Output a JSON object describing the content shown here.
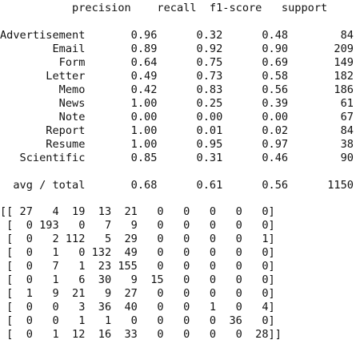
{
  "report": {
    "header": "           precision    recall  f1-score   support",
    "rows": [
      "Advertisement       0.96      0.32      0.48        84",
      "        Email       0.89      0.92      0.90       209",
      "         Form       0.64      0.75      0.69       149",
      "       Letter       0.49      0.73      0.58       182",
      "         Memo       0.42      0.83      0.56       186",
      "         News       1.00      0.25      0.39        61",
      "         Note       0.00      0.00      0.00        67",
      "       Report       1.00      0.01      0.02        84",
      "       Resume       1.00      0.95      0.97        38",
      "   Scientific       0.85      0.31      0.46        90"
    ],
    "avg_total": "  avg / total       0.68      0.61      0.56      1150"
  },
  "confusion_matrix": {
    "rows": [
      "[[ 27   4  19  13  21   0   0   0   0   0]",
      " [  0 193   0   7   9   0   0   0   0   0]",
      " [  0   2 112   5  29   0   0   0   0   1]",
      " [  0   1   0 132  49   0   0   0   0   0]",
      " [  0   7   1  23 155   0   0   0   0   0]",
      " [  0   1   6  30   9  15   0   0   0   0]",
      " [  1   9  21   9  27   0   0   0   0   0]",
      " [  0   0   3  36  40   0   0   1   0   4]",
      " [  0   0   1   1   0   0   0   0  36   0]",
      " [  0   1  12  16  33   0   0   0   0  28]]"
    ]
  }
}
